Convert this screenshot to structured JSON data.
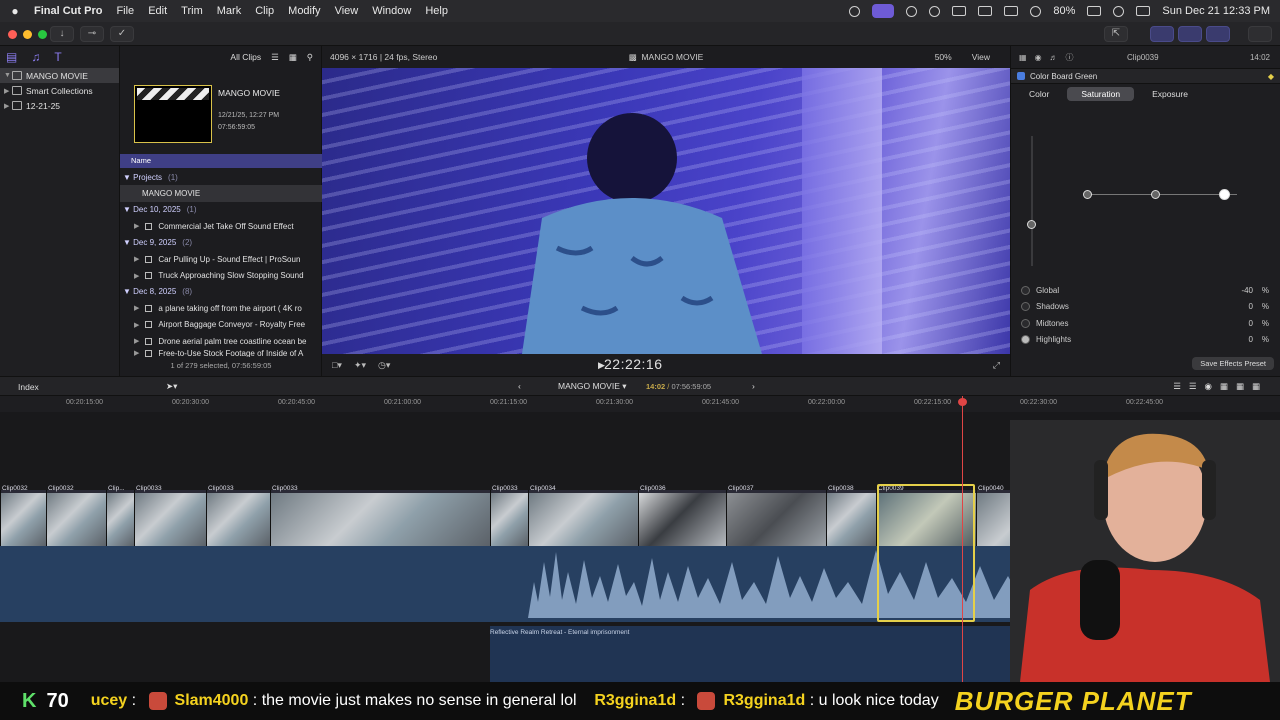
{
  "menubar": {
    "app_name": "Final Cut Pro",
    "items": [
      "File",
      "Edit",
      "Trim",
      "Mark",
      "Clip",
      "Modify",
      "View",
      "Window",
      "Help"
    ],
    "battery": "80%",
    "datetime": "Sun Dec 21  12:33 PM"
  },
  "sidebar": {
    "items": [
      {
        "label": "MANGO MOVIE",
        "selected": true
      },
      {
        "label": "Smart Collections"
      },
      {
        "label": "12-21-25"
      }
    ]
  },
  "browser": {
    "filter": "All Clips",
    "card": {
      "title": "MANGO MOVIE",
      "date": "12/21/25, 12:27 PM",
      "duration": "07:56:59:05"
    },
    "column_name": "Name",
    "rows": [
      {
        "kind": "group",
        "label": "Projects",
        "count": "(1)"
      },
      {
        "kind": "project",
        "label": "MANGO MOVIE"
      },
      {
        "kind": "group",
        "label": "Dec 10, 2025",
        "count": "(1)"
      },
      {
        "kind": "item",
        "label": "Commercial Jet Take Off Sound Effect"
      },
      {
        "kind": "group",
        "label": "Dec 9, 2025",
        "count": "(2)"
      },
      {
        "kind": "item",
        "label": "Car Pulling Up - Sound Effect  |  ProSoun"
      },
      {
        "kind": "item",
        "label": "Truck Approaching Slow Stopping Sound"
      },
      {
        "kind": "group",
        "label": "Dec 8, 2025",
        "count": "(8)"
      },
      {
        "kind": "item",
        "label": "a plane taking off from the airport ( 4K ro"
      },
      {
        "kind": "item",
        "label": "Airport Baggage Conveyor - Royalty Free"
      },
      {
        "kind": "item",
        "label": "Drone aerial palm tree coastline ocean be"
      },
      {
        "kind": "item",
        "label": "Free-to-Use Stock Footage of Inside of A"
      }
    ],
    "status": "1 of 279 selected, 07:56:59:05"
  },
  "viewer": {
    "format": "4096 × 1716 | 24 fps, Stereo",
    "title": "MANGO MOVIE",
    "zoom": "50%",
    "view_label": "View",
    "timecode": "22:22:16"
  },
  "inspector": {
    "clip_name": "Clip0039",
    "duration": "14:02",
    "effect": "Color Board Green",
    "tabs": [
      "Color",
      "Saturation",
      "Exposure"
    ],
    "active_tab": "Saturation",
    "controls": [
      {
        "label": "Global",
        "value": "-40",
        "unit": "%"
      },
      {
        "label": "Shadows",
        "value": "0",
        "unit": "%"
      },
      {
        "label": "Midtones",
        "value": "0",
        "unit": "%"
      },
      {
        "label": "Highlights",
        "value": "0",
        "unit": "%"
      }
    ],
    "save_preset": "Save Effects Preset"
  },
  "timeline": {
    "index_label": "Index",
    "project": "MANGO MOVIE",
    "position": "14:02",
    "total": "07:56:59:05",
    "ruler": [
      "00:20:15:00",
      "00:20:30:00",
      "00:20:45:00",
      "00:21:00:00",
      "00:21:15:00",
      "00:21:30:00",
      "00:21:45:00",
      "00:22:00:00",
      "00:22:15:00",
      "00:22:30:00",
      "00:22:45:00"
    ],
    "clips": [
      "Clip0032",
      "Clip0032",
      "Clip...",
      "Clip0033",
      "Clip0033",
      "Clip0033",
      "Clip0033",
      "Clip0034",
      "Clip0036",
      "Clip0037",
      "Clip0038",
      "Clip0039",
      "Clip0040"
    ],
    "music": "Reflective Realm Retreat - Eternal imprisonment"
  },
  "chat": {
    "k_label": "K",
    "k_value": "70",
    "messages": [
      {
        "user": "ucey",
        "text": ""
      },
      {
        "user": "Slam4000",
        "text": "the movie just makes no sense in general lol"
      },
      {
        "user": "R3ggina1d",
        "text": ""
      },
      {
        "user": "R3ggina1d",
        "text": "u look nice today"
      }
    ],
    "brand": "BURGER PLANET"
  },
  "colors": {
    "accent": "#3f3f86",
    "selection": "#e5d04a",
    "playhead": "#e04545",
    "audio": "#274061"
  }
}
